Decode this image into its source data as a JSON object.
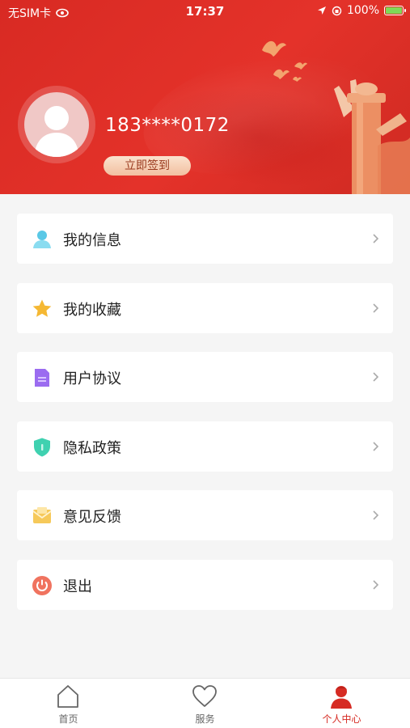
{
  "status_bar": {
    "carrier": "无SIM卡",
    "time": "17:37",
    "battery": "100%"
  },
  "profile": {
    "phone": "183****0172",
    "checkin_label": "立即签到"
  },
  "menu": {
    "items": [
      {
        "label": "我的信息",
        "icon": "user-icon",
        "color": "#5ac8e6"
      },
      {
        "label": "我的收藏",
        "icon": "star-icon",
        "color": "#f5b833"
      },
      {
        "label": "用户协议",
        "icon": "document-icon",
        "color": "#9b6cf0"
      },
      {
        "label": "隐私政策",
        "icon": "shield-icon",
        "color": "#3fd1b0"
      },
      {
        "label": "意见反馈",
        "icon": "envelope-icon",
        "color": "#f6c95a"
      },
      {
        "label": "退出",
        "icon": "power-icon",
        "color": "#f0735f"
      }
    ]
  },
  "tabbar": {
    "tabs": [
      {
        "label": "首页",
        "icon": "home-icon",
        "active": false
      },
      {
        "label": "服务",
        "icon": "heart-icon",
        "active": false
      },
      {
        "label": "个人中心",
        "icon": "person-icon",
        "active": true
      }
    ]
  },
  "colors": {
    "header_red": "#e0302a",
    "accent": "#d62b23"
  }
}
